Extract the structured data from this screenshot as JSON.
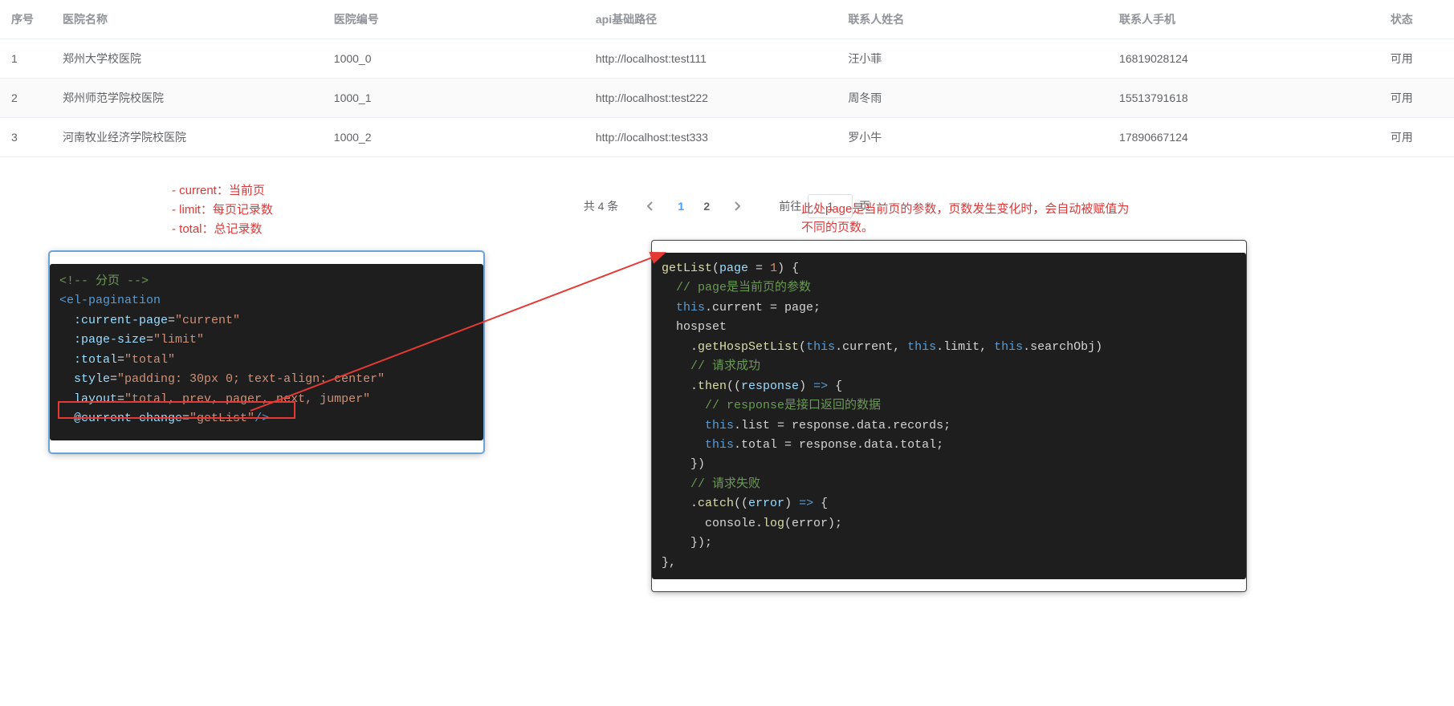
{
  "table": {
    "columns": [
      "序号",
      "医院名称",
      "医院编号",
      "api基础路径",
      "联系人姓名",
      "联系人手机",
      "状态"
    ],
    "rows": [
      {
        "idx": "1",
        "name": "郑州大学校医院",
        "code": "1000_0",
        "api": "http://localhost:test111",
        "cname": "汪小菲",
        "phone": "16819028124",
        "status": "可用"
      },
      {
        "idx": "2",
        "name": "郑州师范学院校医院",
        "code": "1000_1",
        "api": "http://localhost:test222",
        "cname": "周冬雨",
        "phone": "15513791618",
        "status": "可用"
      },
      {
        "idx": "3",
        "name": "河南牧业经济学院校医院",
        "code": "1000_2",
        "api": "http://localhost:test333",
        "cname": "罗小牛",
        "phone": "17890667124",
        "status": "可用"
      }
    ]
  },
  "notes": {
    "line1": "- current：当前页",
    "line2": "- limit：每页记录数",
    "line3": "- total：总记录数"
  },
  "pagination": {
    "total_text": "共 4 条",
    "pages": [
      "1",
      "2"
    ],
    "current": 1,
    "jump_prefix": "前往",
    "jump_suffix": "页",
    "jump_value": "1"
  },
  "right_note": {
    "line1": "此处page是当前页的参数，页数发生变化时，会自动被赋值为",
    "line2": "不同的页数。"
  },
  "left_code": {
    "l1_a": "<!--",
    "l1_b": " 分页 ",
    "l1_c": "-->",
    "l2_a": "<",
    "l2_b": "el-pagination",
    "l3_a": "  :current-page",
    "l3_b": "=",
    "l3_c": "\"current\"",
    "l4_a": "  :page-size",
    "l4_b": "=",
    "l4_c": "\"limit\"",
    "l5_a": "  :total",
    "l5_b": "=",
    "l5_c": "\"total\"",
    "l6_a": "  style",
    "l6_b": "=",
    "l6_c": "\"padding: 30px 0; text-align: center\"",
    "l7_a": "  layout",
    "l7_b": "=",
    "l7_c": "\"total, prev, pager, next, jumper\"",
    "l8_a": "  @current-change",
    "l8_b": "=",
    "l8_c": "\"getList\"",
    "l8_d": "/>"
  },
  "right_code": {
    "r1_a": "getList",
    "r1_b": "(",
    "r1_c": "page",
    "r1_d": " = ",
    "r1_e": "1",
    "r1_f": ") {",
    "r2_a": "  ",
    "r2_b": "// page是当前页的参数",
    "r3_a": "  ",
    "r3_b": "this",
    "r3_c": ".current = page;",
    "r4_a": "  hospset",
    "r5_a": "    .",
    "r5_b": "getHospSetList",
    "r5_c": "(",
    "r5_d": "this",
    "r5_e": ".current, ",
    "r5_f": "this",
    "r5_g": ".limit, ",
    "r5_h": "this",
    "r5_i": ".searchObj)",
    "r6_a": "    ",
    "r6_b": "// 请求成功",
    "r7_a": "    .",
    "r7_b": "then",
    "r7_c": "((",
    "r7_d": "response",
    "r7_e": ") ",
    "r7_f": "=>",
    "r7_g": " {",
    "r8_a": "      ",
    "r8_b": "// response是接口返回的数据",
    "r9_a": "      ",
    "r9_b": "this",
    "r9_c": ".list = response.data.records;",
    "r10_a": "      ",
    "r10_b": "this",
    "r10_c": ".total = response.data.total;",
    "r11_a": "    })",
    "r12_a": "    ",
    "r12_b": "// 请求失败",
    "r13_a": "    .",
    "r13_b": "catch",
    "r13_c": "((",
    "r13_d": "error",
    "r13_e": ") ",
    "r13_f": "=>",
    "r13_g": " {",
    "r14_a": "      console.",
    "r14_b": "log",
    "r14_c": "(error);",
    "r15_a": "    });",
    "r16_a": "},"
  }
}
